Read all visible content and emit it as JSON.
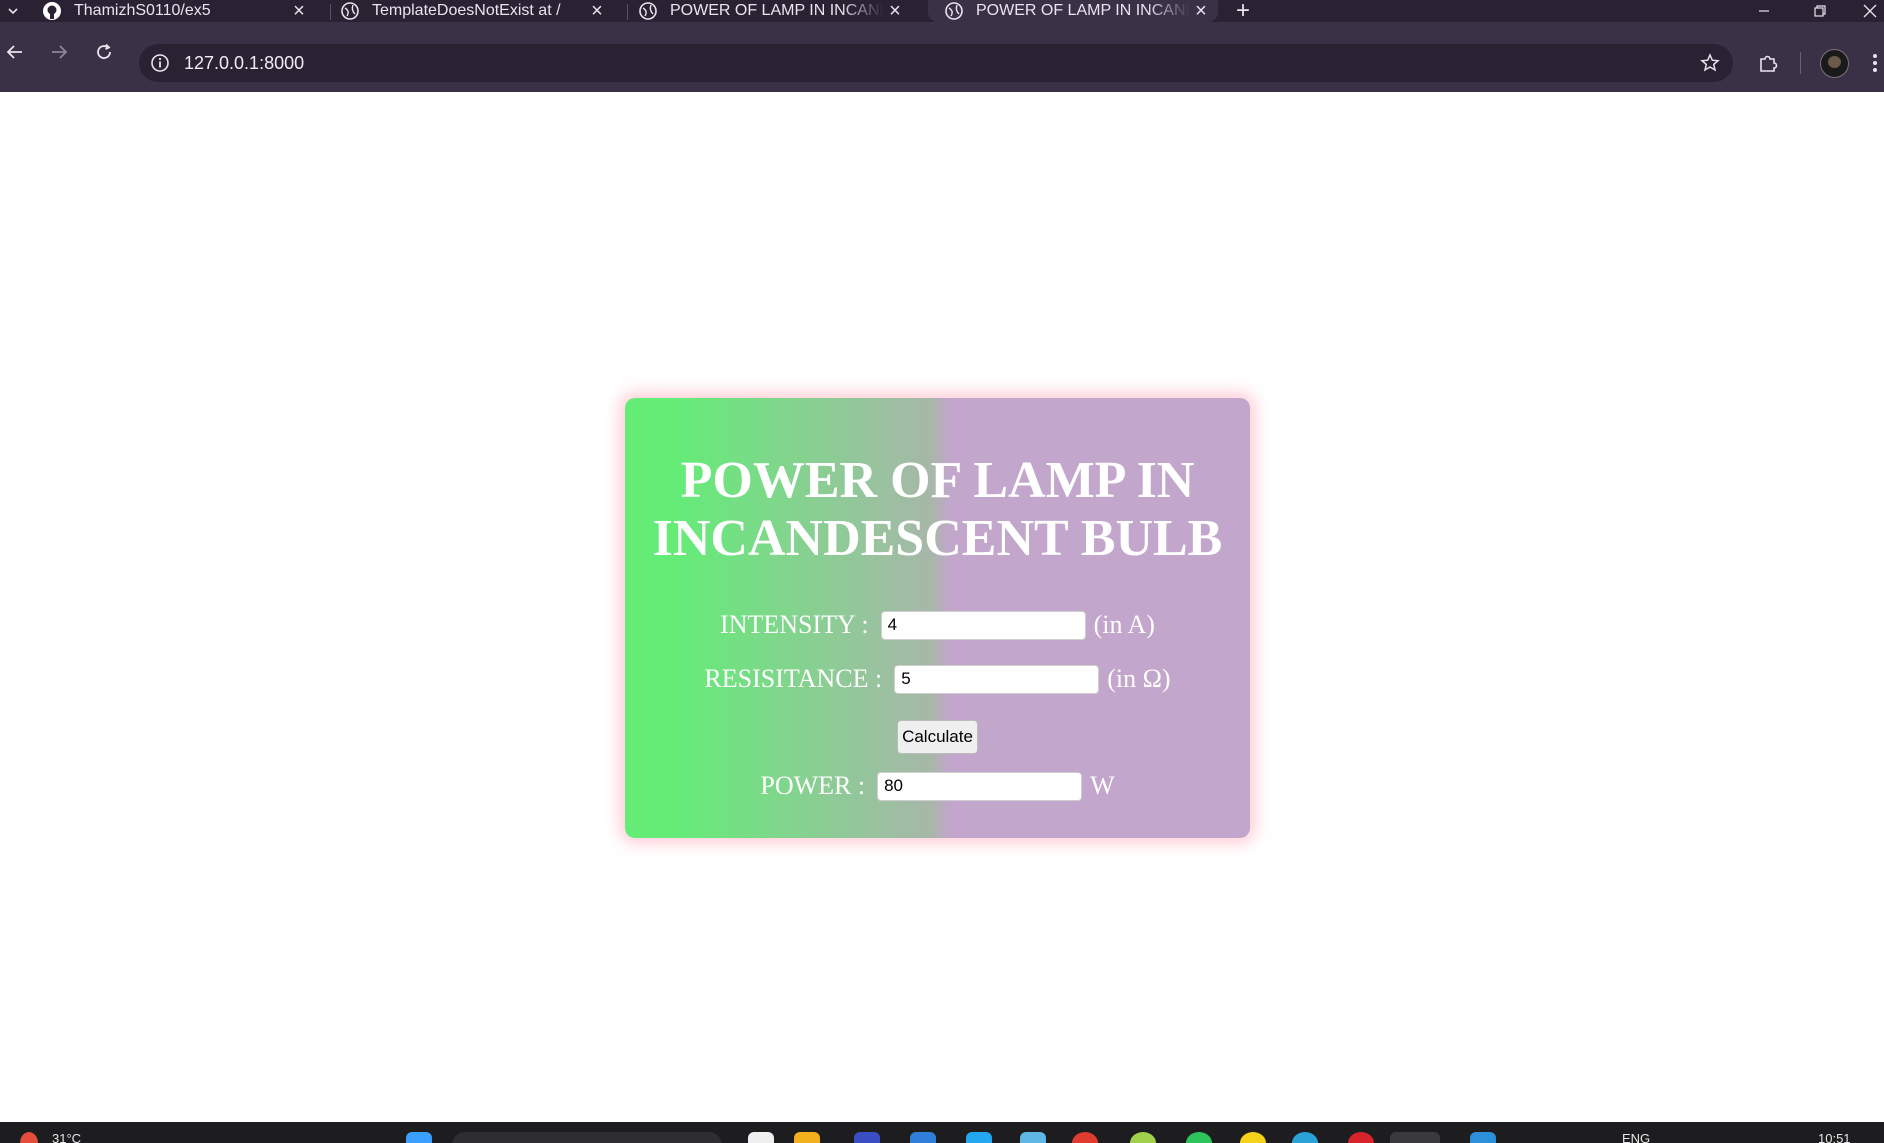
{
  "browser": {
    "tabs": [
      {
        "title": "ThamizhS0110/ex5",
        "icon": "github-icon",
        "active": false
      },
      {
        "title": "TemplateDoesNotExist at /",
        "icon": "globe-icon",
        "active": false
      },
      {
        "title": "POWER OF LAMP IN INCANDES",
        "icon": "globe-icon",
        "active": false
      },
      {
        "title": "POWER OF LAMP IN INCANDES",
        "icon": "globe-icon",
        "active": true
      }
    ],
    "url": "127.0.0.1:8000"
  },
  "page": {
    "title_line1": "POWER OF LAMP IN",
    "title_line2": "INCANDESCENT BULB",
    "intensity": {
      "label": "INTENSITY :",
      "value": "4",
      "unit": "(in A)"
    },
    "resistance": {
      "label": "RESISITANCE :",
      "value": "5",
      "unit": "(in Ω)"
    },
    "calculate_label": "Calculate",
    "power": {
      "label": "POWER :",
      "value": "80",
      "unit": "W"
    }
  },
  "taskbar": {
    "weather": "31°C",
    "language": "ENG",
    "time": "10:51"
  },
  "colors": {
    "card_gradient_start": "#64ec77",
    "card_gradient_end": "#c3a6cc",
    "card_glow": "#ff8ca0",
    "chrome_dark": "#2a2133",
    "chrome_toolbar": "#3b3147"
  }
}
